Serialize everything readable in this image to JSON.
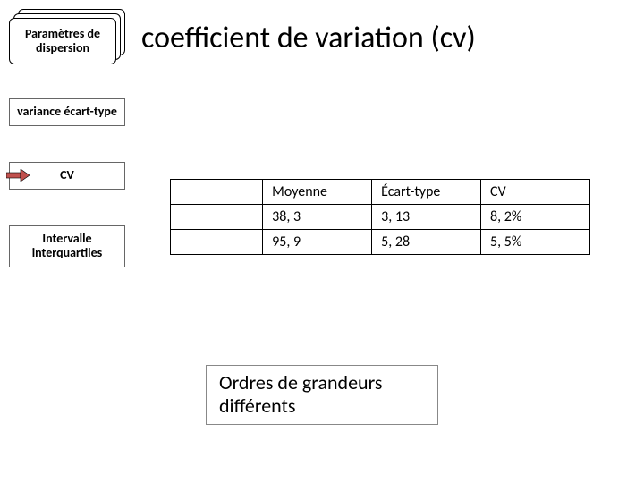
{
  "header": {
    "stack_label": "Paramètres de dispersion",
    "title": "coefficient de variation (cv)"
  },
  "sidebar": {
    "box1": "variance écart-type",
    "box2": "CV",
    "box3": "Intervalle interquartiles"
  },
  "table": {
    "headers": {
      "c1": "Moyenne",
      "c2": "Écart-type",
      "c3": "CV"
    },
    "rows": [
      {
        "c1": "38, 3",
        "c2": "3, 13",
        "c3": "8, 2%"
      },
      {
        "c1": "95, 9",
        "c2": "5, 28",
        "c3": "5, 5%"
      }
    ]
  },
  "callout": "Ordres de grandeurs différents",
  "chart_data": {
    "type": "table",
    "title": "coefficient de variation (cv)",
    "columns": [
      "Moyenne",
      "Écart-type",
      "CV"
    ],
    "rows": [
      [
        "38, 3",
        "3, 13",
        "8, 2%"
      ],
      [
        "95, 9",
        "5, 28",
        "5, 5%"
      ]
    ]
  }
}
